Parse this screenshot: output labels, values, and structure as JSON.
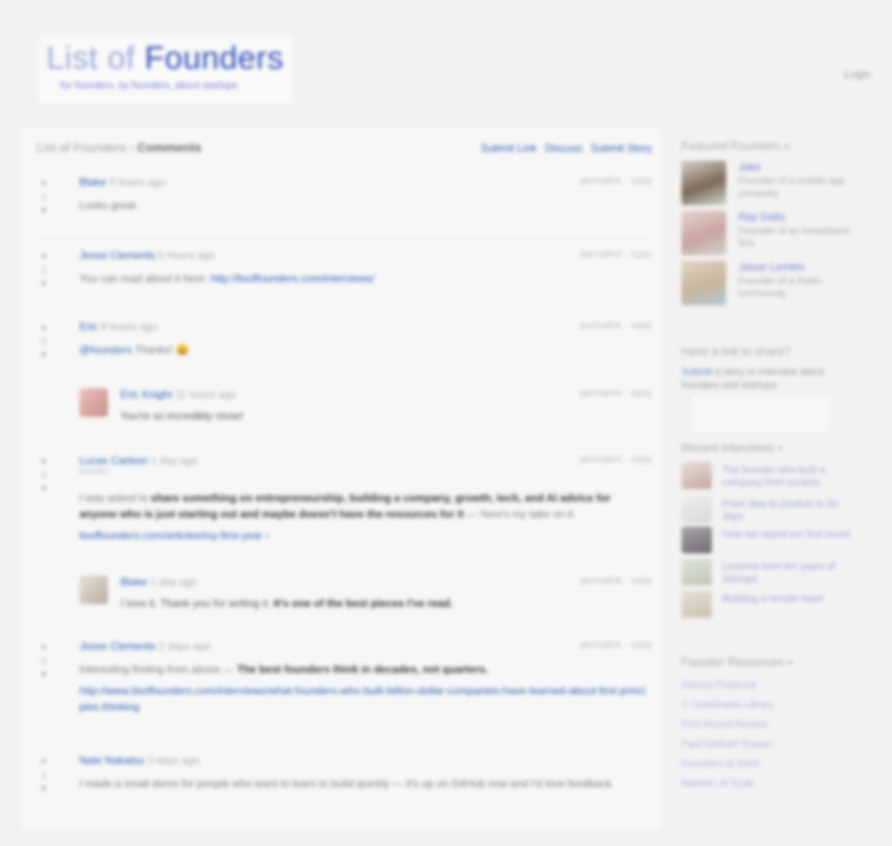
{
  "header": {
    "logo_part1": "List of ",
    "logo_part2": "Founders",
    "logo_sub": "for founders, by founders, about startups",
    "top_link": "Login"
  },
  "main": {
    "crumb_prefix": "List of Founders ›",
    "crumb_title": "Comments",
    "actions": [
      "Submit Link",
      "Discuss",
      "Submit Story"
    ],
    "posts": [
      {
        "votes": "1",
        "meta_author": "Blake",
        "meta_rest": " 3 hours ago",
        "time": "permalink · reply",
        "body": "Looks great."
      },
      {
        "votes": "2",
        "meta_author": "Jesse Clements",
        "meta_rest": " 5 hours ago",
        "time": "permalink · reply",
        "body_text": "You can read about it here: ",
        "body_link": "http://lisoffounders.com/interviews/"
      },
      {
        "votes": "0",
        "meta_author": "Eric",
        "meta_rest": " 9 hours ago",
        "time": "permalink · reply",
        "body_link": "@founders",
        "body_text": " Thanks! 😀",
        "reply": {
          "meta_author": "Eric Knight",
          "meta_rest": " 11 hours ago",
          "time": "permalink · reply",
          "body": "You're so incredibly close!"
        }
      },
      {
        "votes": "4",
        "meta_author": "Lucas Carlson",
        "meta_rest": " 1 day ago",
        "sub": "founder",
        "time": "permalink · reply",
        "body_line1_pre": "I was asked to ",
        "body_line1_bold": "share something on entrepreneurship, building a company, growth, tech, and AI advice for",
        "body_line2_bold": "anyone who is just starting out and maybe doesn't have the resources for it",
        "body_line2_rest": " — here's my take on it.",
        "body_link": "lisoffounders.com/articles/my-first-year ›",
        "reply": {
          "meta_author": "Blake",
          "meta_rest": " 1 day ago",
          "time": "permalink · reply",
          "body_pre": "I love it. Thank you for writing it. ",
          "body_bold": "It's one of the best pieces I've read."
        }
      },
      {
        "votes": "3",
        "meta_author": "Jesse Clements",
        "meta_rest": " 2 days ago",
        "time": "permalink · reply",
        "body_pre": "Interesting finding from above — ",
        "body_bold": "The best founders think in decades, not quarters.",
        "body_link": "http://www.lisoffounders.com/interviews/what-founders-who-built-billion-dollar-companies-have-learned-about-first-principles-thinking"
      },
      {
        "votes": "1",
        "meta_author": "Nate Nakatsu",
        "meta_rest": " 3 days ago",
        "time": "",
        "body": "I made a small demo for people who want to learn to build quickly — it's up on GitHub now and I'd love feedback."
      }
    ]
  },
  "sidebar": {
    "featured_title": "Featured Founders »",
    "members": [
      {
        "name": "Jake",
        "desc": "Founder of a mobile app company"
      },
      {
        "name": "Ray Dalio",
        "desc": "Founder of an investment firm"
      },
      {
        "name": "Jason Lemkin",
        "desc": "Founder of a SaaS community"
      }
    ],
    "promo_title": "Have a link to share?",
    "promo_text_link": "Submit",
    "promo_text_rest": " a story or interview about founders and startups.",
    "recent_title": "Recent Interviews »",
    "recent": [
      "The founder who built a company from scratch",
      "From idea to product in 30 days",
      "How we raised our first round",
      "Lessons from ten years of startups",
      "Building a remote team"
    ],
    "links_title": "Founder Resources »",
    "links": [
      "Startup Playbook",
      "Y Combinator Library",
      "First Round Review",
      "Paul Graham Essays",
      "Founders at Work",
      "Masters of Scale"
    ]
  }
}
